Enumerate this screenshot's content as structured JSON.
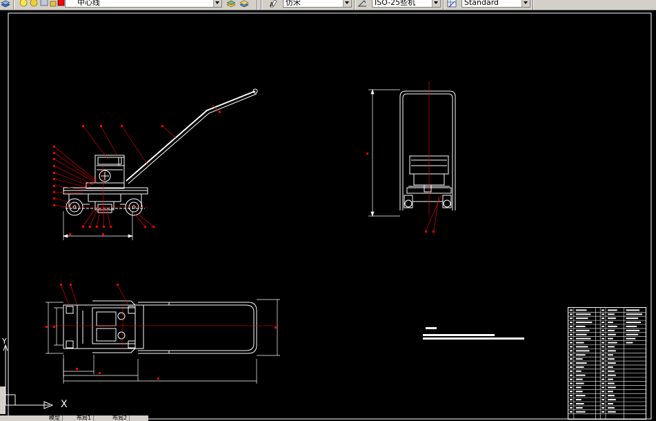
{
  "toolbar": {
    "layer_combo": {
      "value": "中心线",
      "layer_color": "#ff0000"
    },
    "textstyle_combo": {
      "value": "仿宋"
    },
    "dimstyle_combo": {
      "value": "ISO-25些机"
    },
    "tablestyle_combo": {
      "value": "Standard"
    }
  },
  "ucs": {
    "x_label": "X",
    "y_label": "Y"
  },
  "layout_tabs": [
    "模型",
    "布局1",
    "布局2"
  ],
  "colors": {
    "canvas_background": "#000000",
    "linework": "#ffffff",
    "annotation": "#ff0000",
    "toolbar": "#d4d0c8"
  }
}
